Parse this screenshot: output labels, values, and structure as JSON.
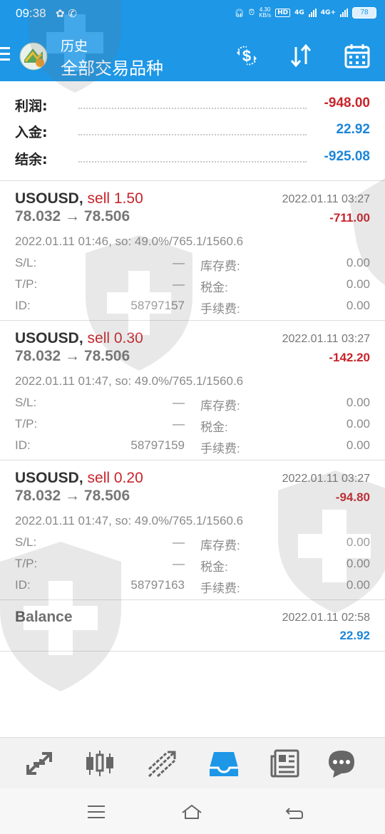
{
  "status_bar": {
    "time": "09:38",
    "speed_value": "4.30",
    "speed_unit": "KB/s",
    "hd": "HD",
    "net1": "4G",
    "net2": "4G+",
    "battery": "78"
  },
  "header": {
    "subtitle": "历史",
    "title": "全部交易品种",
    "icons": [
      "menu-icon",
      "app-logo",
      "currency-exchange-icon",
      "sort-icon",
      "calendar-icon"
    ]
  },
  "summary": {
    "profit_label": "利润:",
    "profit_value": "-948.00",
    "deposit_label": "入金:",
    "deposit_value": "22.92",
    "balance_label": "结余:",
    "balance_value": "-925.08"
  },
  "colors": {
    "header_bg": "#1d97e6",
    "loss_red": "#c8242b",
    "positive_blue": "#1d86d8"
  },
  "deals": [
    {
      "symbol": "USOUSD,",
      "side": "sell 1.50",
      "prices": "78.032 → 78.506",
      "close_time": "2022.01.11 03:27",
      "profit": "-711.00",
      "open_info": "2022.01.11 01:46, so: 49.0%/765.1/1560.6",
      "sl_label": "S/L:",
      "sl": "—",
      "tp_label": "T/P:",
      "tp": "—",
      "id_label": "ID:",
      "id": "58797157",
      "swap_label": "库存费:",
      "swap": "0.00",
      "tax_label": "税金:",
      "tax": "0.00",
      "fee_label": "手续费:",
      "fee": "0.00"
    },
    {
      "symbol": "USOUSD,",
      "side": "sell 0.30",
      "prices": "78.032 → 78.506",
      "close_time": "2022.01.11 03:27",
      "profit": "-142.20",
      "open_info": "2022.01.11 01:47, so: 49.0%/765.1/1560.6",
      "sl_label": "S/L:",
      "sl": "—",
      "tp_label": "T/P:",
      "tp": "—",
      "id_label": "ID:",
      "id": "58797159",
      "swap_label": "库存费:",
      "swap": "0.00",
      "tax_label": "税金:",
      "tax": "0.00",
      "fee_label": "手续费:",
      "fee": "0.00"
    },
    {
      "symbol": "USOUSD,",
      "side": "sell 0.20",
      "prices": "78.032 → 78.506",
      "close_time": "2022.01.11 03:27",
      "profit": "-94.80",
      "open_info": "2022.01.11 01:47, so: 49.0%/765.1/1560.6",
      "sl_label": "S/L:",
      "sl": "—",
      "tp_label": "T/P:",
      "tp": "—",
      "id_label": "ID:",
      "id": "58797163",
      "swap_label": "库存费:",
      "swap": "0.00",
      "tax_label": "税金:",
      "tax": "0.00",
      "fee_label": "手续费:",
      "fee": "0.00"
    }
  ],
  "balance_op": {
    "label": "Balance",
    "time": "2022.01.11 02:58",
    "value": "22.92"
  },
  "tabbar": {
    "items": [
      "quotes-icon",
      "chart-icon",
      "trade-icon",
      "history-icon",
      "news-icon",
      "messages-icon"
    ],
    "active": "history-icon"
  },
  "system_nav": [
    "menu-nav-icon",
    "home-nav-icon",
    "back-nav-icon"
  ]
}
